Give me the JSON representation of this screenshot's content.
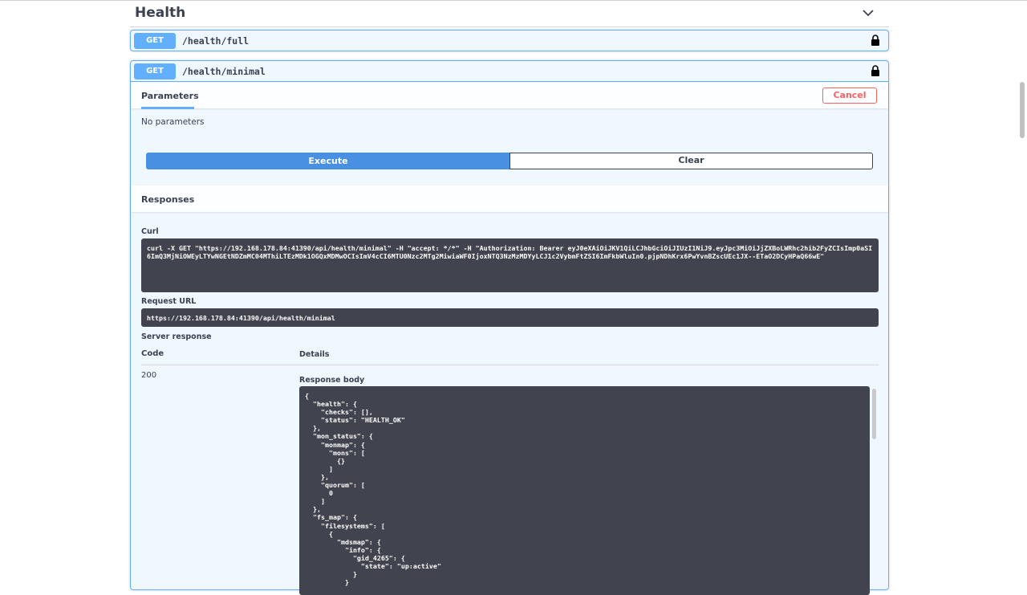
{
  "tag": {
    "title": "Health",
    "chevron_icon": "chevron-down-icon"
  },
  "operations": [
    {
      "method": "GET",
      "path": "/health/full",
      "lock_icon": "lock-icon"
    },
    {
      "method": "GET",
      "path": "/health/minimal",
      "lock_icon": "lock-icon"
    }
  ],
  "parameters": {
    "tab_label": "Parameters",
    "cancel_label": "Cancel",
    "empty_text": "No parameters"
  },
  "actions": {
    "execute_label": "Execute",
    "clear_label": "Clear"
  },
  "responses": {
    "title": "Responses",
    "curl_label": "Curl",
    "curl_text": "curl -X GET \"https://192.168.178.84:41390/api/health/minimal\" -H \"accept: */*\" -H \"Authorization: Bearer eyJ0eXAiOiJKV1QiLCJhbGciOiJIUzI1NiJ9.eyJpc3MiOiJjZXBoLWRhc2hib2FyZCIsImp0aSI6ImQ3MjNiOWEyLTYwNGEtNDZmMC04MThiLTEzMDk1OGQxMDMwOCIsImV4cCI6MTU0Nzc2MTg2MiwiaWF0IjoxNTQ3NzMzMDYyLCJ1c2VybmFtZSI6ImFkbWluIn0.pjpNDhKrx6PwYvnBZscUEc1JX--ETaO2DCyHPaQ66wE\"",
    "request_url_label": "Request URL",
    "request_url": "https://192.168.178.84:41390/api/health/minimal",
    "server_response_label": "Server response",
    "code_header": "Code",
    "details_header": "Details",
    "code": "200",
    "body_label": "Response body",
    "body_text": "{\n  \"health\": {\n    \"checks\": [],\n    \"status\": \"HEALTH_OK\"\n  },\n  \"mon_status\": {\n    \"monmap\": {\n      \"mons\": [\n        {}\n      ]\n    },\n    \"quorum\": [\n      0\n    ]\n  },\n  \"fs_map\": {\n    \"filesystems\": [\n      {\n        \"mdsmap\": {\n          \"info\": {\n            \"gid_4265\": {\n              \"state\": \"up:active\"\n            }\n          }"
  },
  "colors": {
    "get_method": "#61affe",
    "execute": "#4990e2",
    "cancel": "#ff6060",
    "code_bg": "#41444e"
  }
}
